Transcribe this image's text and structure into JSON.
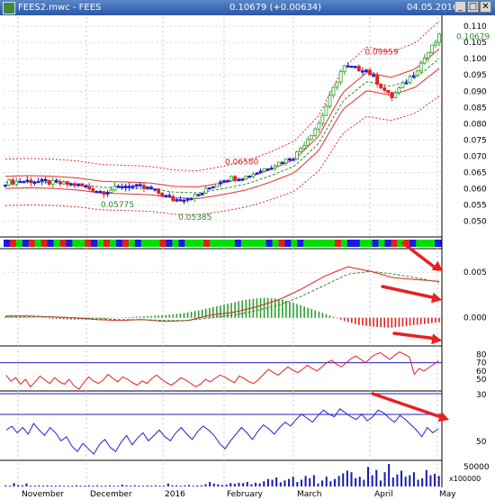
{
  "window": {
    "title": "FEES2.mwc - FEES",
    "quote": "0.10679 (+0.00634)",
    "date": "04.05.2016",
    "buttons": [
      "_",
      "□",
      "✕"
    ]
  },
  "chart_data": [
    {
      "type": "candlestick",
      "panel": "price",
      "yticks": [
        0.11,
        0.105,
        0.1,
        0.095,
        0.09,
        0.085,
        0.08,
        0.075,
        0.07,
        0.065,
        0.06,
        0.055,
        0.05
      ],
      "ytick_labels": [
        "0.110",
        "0.105",
        "0.100",
        "0.095",
        "0.090",
        "0.085",
        "0.080",
        "0.075",
        "0.070",
        "0.065",
        "0.060",
        "0.055",
        "0.050"
      ],
      "ylim": [
        0.0455,
        0.1125
      ],
      "last_price": 0.10679,
      "last_label": "0.10679",
      "annotations": [
        {
          "text": "0.05775",
          "x": "2015-12-10",
          "y": 0.05775,
          "color": "#2d8a2d"
        },
        {
          "text": "0.05385",
          "x": "2016-01-14",
          "y": 0.05385,
          "color": "#2d8a2d"
        },
        {
          "text": "0.06580",
          "x": "2016-02-04",
          "y": 0.0658,
          "color": "#d02020"
        },
        {
          "text": "0.09959",
          "x": "2016-04-07",
          "y": 0.09959,
          "color": "#d02020"
        }
      ],
      "series": [
        {
          "name": "close",
          "x": [
            "2015-10-20",
            "2015-11-01",
            "2015-11-15",
            "2015-12-01",
            "2015-12-10",
            "2015-12-20",
            "2016-01-01",
            "2016-01-14",
            "2016-01-25",
            "2016-02-04",
            "2016-02-15",
            "2016-03-01",
            "2016-03-15",
            "2016-03-25",
            "2016-04-07",
            "2016-04-15",
            "2016-04-20",
            "2016-04-28",
            "2016-05-04"
          ],
          "values": [
            0.062,
            0.0625,
            0.0618,
            0.0612,
            0.059,
            0.061,
            0.06,
            0.0565,
            0.058,
            0.063,
            0.0638,
            0.067,
            0.07,
            0.08,
            0.0975,
            0.0965,
            0.088,
            0.096,
            0.10679
          ]
        },
        {
          "name": "ema",
          "values": [
            0.062,
            0.0622,
            0.062,
            0.0615,
            0.0605,
            0.0603,
            0.06,
            0.059,
            0.0588,
            0.06,
            0.0615,
            0.064,
            0.067,
            0.074,
            0.087,
            0.093,
            0.0915,
            0.094,
            0.1
          ]
        }
      ]
    },
    {
      "type": "heatmap",
      "panel": "colour-strip",
      "values": [
        "blue",
        "red",
        "green",
        "blue",
        "red",
        "green",
        "red",
        "blue",
        "green",
        "red",
        "blue",
        "green",
        "green",
        "red",
        "blue",
        "green",
        "red",
        "green",
        "blue",
        "red",
        "green",
        "blue",
        "green",
        "green",
        "green",
        "red",
        "blue",
        "green",
        "blue",
        "green",
        "green",
        "green",
        "red",
        "green",
        "green",
        "green",
        "green",
        "blue",
        "green",
        "green",
        "green",
        "green",
        "blue",
        "green",
        "red",
        "blue",
        "green",
        "blue",
        "green",
        "green",
        "green",
        "green",
        "green",
        "red",
        "green",
        "blue",
        "blue",
        "green",
        "green",
        "blue",
        "green",
        "blue",
        "red",
        "green",
        "red",
        "blue",
        "green",
        "green",
        "green",
        "blue"
      ],
      "colors": {
        "green": "#00e000",
        "red": "#e02020",
        "blue": "#1a1ae0"
      }
    },
    {
      "type": "bar",
      "panel": "macd",
      "yticks": [
        0.005,
        0.0
      ],
      "ytick_labels": [
        "0.005",
        "0.000"
      ],
      "ylim": [
        -0.003,
        0.0075
      ],
      "series": [
        {
          "name": "histogram",
          "values": [
            0.0001,
            0.0001,
            0.0,
            -0.0001,
            -0.0002,
            -0.0002,
            -0.0001,
            0.0,
            0.0001,
            0.0002,
            0.0003,
            0.0005,
            0.0008,
            0.0012,
            0.0016,
            0.002,
            0.0022,
            0.0021,
            0.0016,
            0.001,
            0.0004,
            -0.0003,
            -0.0008,
            -0.001,
            -0.0011,
            -0.0009,
            -0.0007,
            -0.0005
          ]
        },
        {
          "name": "macd",
          "values": [
            0.0002,
            0.0002,
            0.0001,
            0.0,
            -0.0002,
            -0.0003,
            -0.0002,
            -0.0004,
            -0.0003,
            0.0003,
            0.0006,
            0.0012,
            0.002,
            0.0032,
            0.0046,
            0.0056,
            0.0051,
            0.0044,
            0.0042,
            0.004
          ]
        },
        {
          "name": "signal",
          "values": [
            0.0001,
            0.0001,
            0.0001,
            0.0,
            -0.0001,
            -0.0002,
            -0.0002,
            -0.0003,
            -0.0003,
            0.0,
            0.0003,
            0.0008,
            0.0014,
            0.0024,
            0.0036,
            0.0048,
            0.0051,
            0.0048,
            0.0044,
            0.0039
          ]
        }
      ]
    },
    {
      "type": "line",
      "panel": "rsi",
      "yticks": [
        80,
        70,
        60,
        50
      ],
      "ytick_labels": [
        "80",
        "70",
        "60",
        "50"
      ],
      "ylim": [
        37,
        88
      ],
      "reference_lines": [
        70
      ],
      "values": [
        55,
        48,
        52,
        44,
        50,
        41,
        47,
        54,
        49,
        45,
        52,
        47,
        44,
        50,
        42,
        38,
        46,
        53,
        48,
        45,
        49,
        56,
        51,
        47,
        53,
        50,
        46,
        43,
        48,
        45,
        51,
        55,
        50,
        46,
        43,
        47,
        52,
        49,
        45,
        41,
        44,
        50,
        47,
        51,
        55,
        53,
        49,
        46,
        54,
        51,
        47,
        45,
        50,
        56,
        62,
        58,
        55,
        60,
        65,
        61,
        58,
        62,
        67,
        63,
        60,
        65,
        70,
        73,
        68,
        65,
        70,
        75,
        78,
        74,
        70,
        76,
        80,
        82,
        78,
        74,
        79,
        83,
        80,
        77,
        56,
        63,
        60,
        64,
        68,
        72
      ]
    },
    {
      "type": "line",
      "panel": "oscillator",
      "yticks": [
        30,
        50
      ],
      "ytick_labels": [
        "30",
        "50"
      ],
      "ylim": [
        38,
        88
      ],
      "reference_lines": [
        50
      ],
      "values": [
        60,
        63,
        58,
        62,
        57,
        65,
        60,
        56,
        62,
        58,
        52,
        55,
        48,
        44,
        50,
        46,
        42,
        49,
        53,
        47,
        44,
        51,
        56,
        49,
        54,
        58,
        52,
        56,
        60,
        55,
        52,
        58,
        62,
        57,
        53,
        59,
        63,
        60,
        56,
        50,
        46,
        52,
        57,
        62,
        58,
        53,
        59,
        64,
        61,
        57,
        62,
        66,
        63,
        68,
        72,
        69,
        66,
        71,
        75,
        72,
        70,
        76,
        73,
        70,
        68,
        72,
        67,
        70,
        75,
        73,
        69,
        66,
        71,
        68,
        64,
        60,
        55,
        62,
        58,
        61
      ]
    },
    {
      "type": "bar",
      "panel": "volume",
      "yticks": [
        50000
      ],
      "ytick_labels": [
        "50000"
      ],
      "ylim": [
        0,
        90000
      ],
      "unit_label": "x100000",
      "x_labels": [
        "November",
        "December",
        "2016",
        "February",
        "March",
        "April",
        "May"
      ],
      "values": [
        3,
        2,
        9,
        4,
        3,
        8,
        2,
        2,
        3,
        2,
        3,
        2,
        2,
        3,
        2,
        2,
        2,
        3,
        2,
        2,
        3,
        2,
        3,
        2,
        2,
        3,
        2,
        2,
        5,
        3,
        2,
        3,
        2,
        2,
        3,
        2,
        3,
        2,
        2,
        8,
        3,
        3,
        2,
        3,
        4,
        2,
        3,
        3,
        6,
        12,
        8,
        6,
        4,
        5,
        9,
        7,
        10,
        9,
        12,
        6,
        10,
        8,
        14,
        20,
        18,
        24,
        11,
        16,
        20,
        26,
        12,
        18,
        28,
        22,
        30,
        8,
        16,
        26,
        14,
        20,
        28,
        35,
        42,
        38,
        22,
        26,
        18,
        52,
        30,
        44,
        16,
        38,
        60,
        24,
        32,
        42,
        26,
        30,
        38,
        18,
        22,
        44,
        30,
        34,
        28
      ]
    }
  ]
}
